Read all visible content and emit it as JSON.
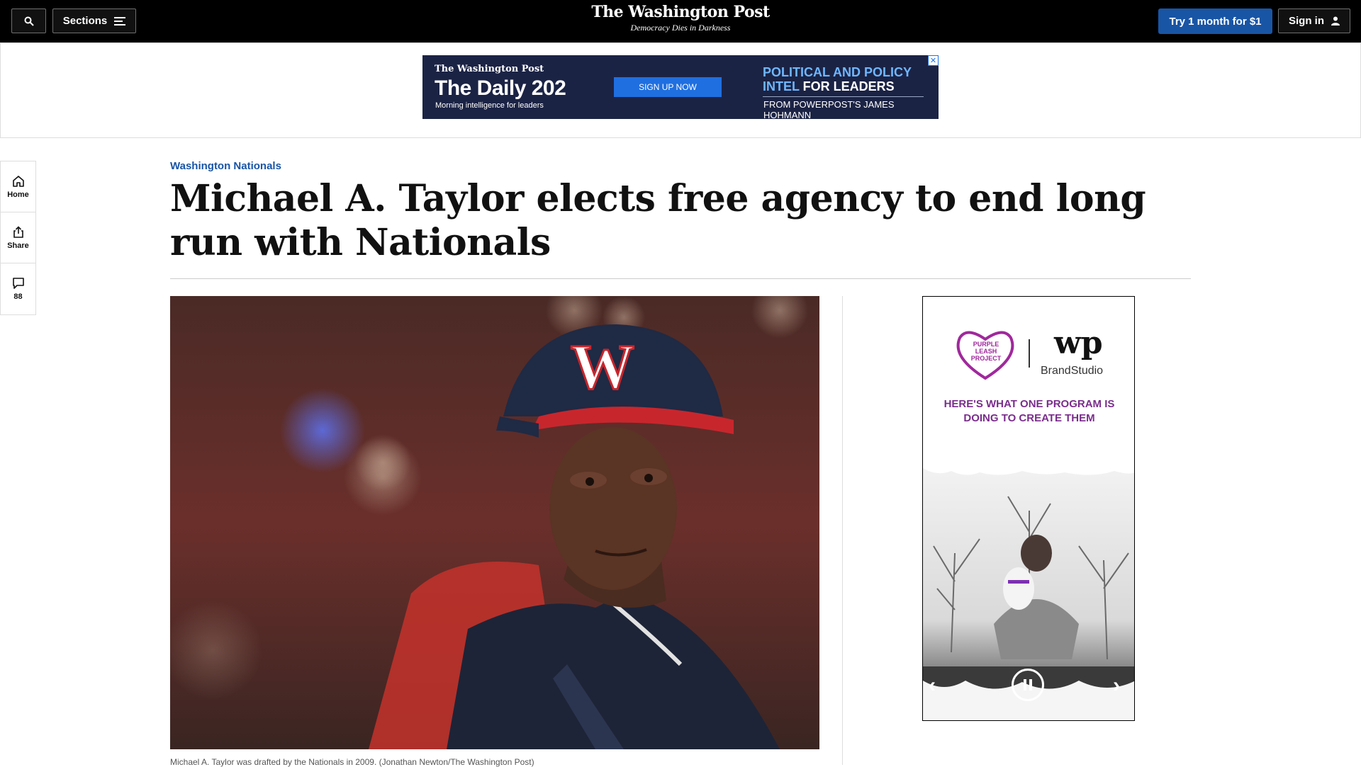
{
  "nav": {
    "sections_label": "Sections",
    "logo": "The Washington Post",
    "tagline": "Democracy Dies in Darkness",
    "try_label": "Try 1 month for $1",
    "signin_label": "Sign in"
  },
  "banner_ad": {
    "logo": "The Washington Post",
    "title": "The Daily 202",
    "subtitle": "Morning intelligence for leaders",
    "cta": "SIGN UP NOW",
    "headline_line1": "POLITICAL AND POLICY",
    "headline_line2a": "INTEL ",
    "headline_line2b": "FOR LEADERS",
    "from": "FROM POWERPOST'S JAMES HOHMANN"
  },
  "rail": {
    "home": "Home",
    "share": "Share",
    "comments": "88"
  },
  "article": {
    "kicker": "Washington Nationals",
    "headline": "Michael A. Taylor elects free agency to end long run with Nationals",
    "caption": "Michael A. Taylor was drafted by the Nationals in 2009. (Jonathan Newton/The Washington Post)"
  },
  "side_ad": {
    "partner_top": "PURPLE",
    "partner_mid": "LEASH",
    "partner_bot": "PROJECT",
    "wp_mark": "wp",
    "brandstudio": "BrandStudio",
    "promo": "HERE'S WHAT ONE PROGRAM IS DOING TO CREATE THEM"
  },
  "colors": {
    "accent_blue": "#1955a5",
    "ad_navy": "#1b2345",
    "ad_purple": "#7a2d8c"
  }
}
